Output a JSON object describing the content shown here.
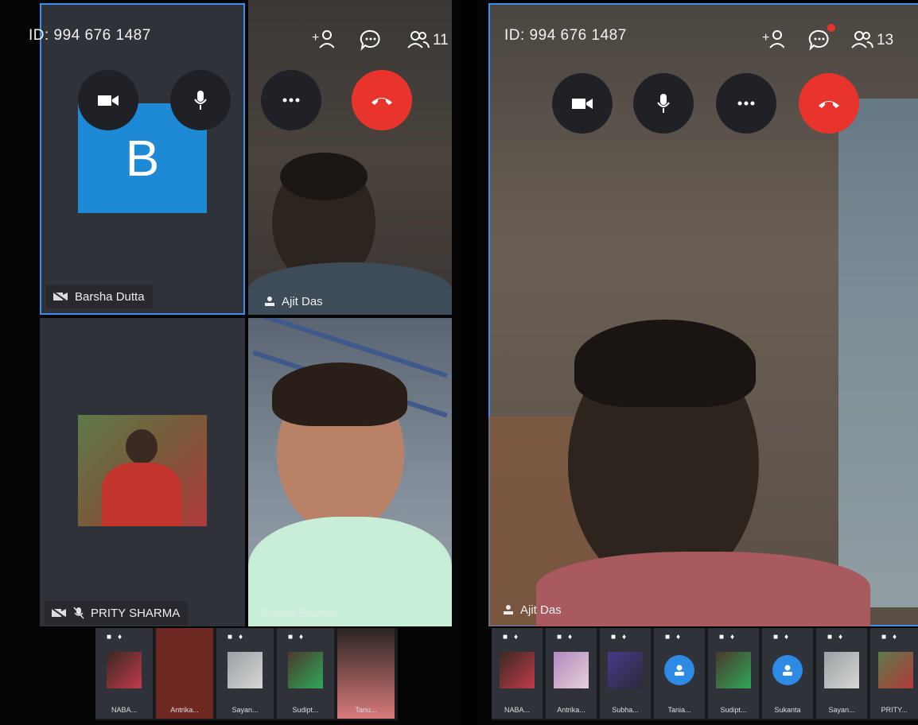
{
  "left_screen": {
    "meeting_id": "ID: 994 676 1487",
    "participant_count": "11",
    "avatar_letter": "B",
    "tiles": [
      {
        "name": "Barsha Dutta"
      },
      {
        "name": "Ajit Das"
      },
      {
        "name": "PRITY SHARMA"
      },
      {
        "name": "Subha Biswas"
      }
    ],
    "thumbnails": [
      "NABA...",
      "Antrika...",
      "Sayan...",
      "Sudipt...",
      "Tanu..."
    ]
  },
  "right_screen": {
    "meeting_id": "ID: 994 676 1487",
    "participant_count": "13",
    "active_speaker": "Ajit Das",
    "thumbnails": [
      "NABA...",
      "Antrika...",
      "Subha...",
      "Tania...",
      "Sudipt...",
      "Sukanta",
      "Sayan...",
      "PRITY..."
    ]
  },
  "icons": {
    "add_participant": "add-person-icon",
    "chat": "chat-bubble-icon",
    "participants": "people-icon",
    "video": "video-camera-icon",
    "mic": "microphone-icon",
    "more": "more-options-icon",
    "end_call": "end-call-icon"
  },
  "colors": {
    "selection_border": "#3d8ee8",
    "end_call": "#e8342d",
    "avatar_blue": "#1e8ad6",
    "unread_dot": "#e8342d"
  }
}
